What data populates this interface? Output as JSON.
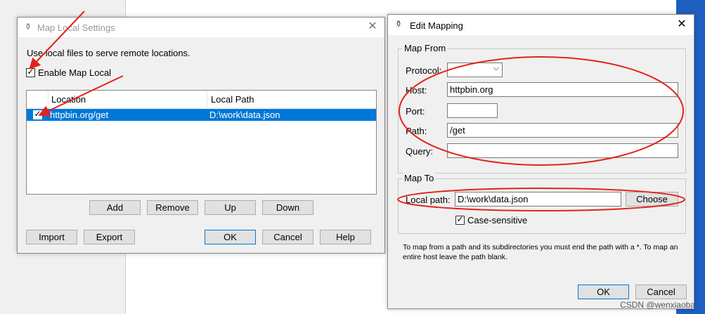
{
  "map_local_settings": {
    "title": "Map Local Settings",
    "description": "Use local files to serve remote locations.",
    "enable_label": "Enable Map Local",
    "table": {
      "headers": [
        "Location",
        "Local Path"
      ],
      "rows": [
        {
          "location": "httpbin.org/get",
          "local_path": "D:\\work\\data.json",
          "checked": true
        }
      ]
    },
    "buttons": {
      "add": "Add",
      "remove": "Remove",
      "up": "Up",
      "down": "Down",
      "import": "Import",
      "export": "Export",
      "ok": "OK",
      "cancel": "Cancel",
      "help": "Help"
    }
  },
  "edit_mapping": {
    "title": "Edit Mapping",
    "map_from": {
      "legend": "Map From",
      "protocol_label": "Protocol:",
      "protocol_value": "",
      "host_label": "Host:",
      "host_value": "httpbin.org",
      "port_label": "Port:",
      "port_value": "",
      "path_label": "Path:",
      "path_value": "/get",
      "query_label": "Query:",
      "query_value": ""
    },
    "map_to": {
      "legend": "Map To",
      "local_path_label": "Local path:",
      "local_path_value": "D:\\work\\data.json",
      "choose_label": "Choose",
      "case_sensitive_label": "Case-sensitive"
    },
    "help_text": "To map from a path and its subdirectories you must end the path with a *. To map an entire host leave the path blank.",
    "buttons": {
      "ok": "OK",
      "cancel": "Cancel"
    }
  },
  "watermark": "CSDN @wenxiaoba",
  "colors": {
    "selection": "#0078d7",
    "annotation": "#e3231b",
    "taskbar": "#1e5fc2"
  }
}
